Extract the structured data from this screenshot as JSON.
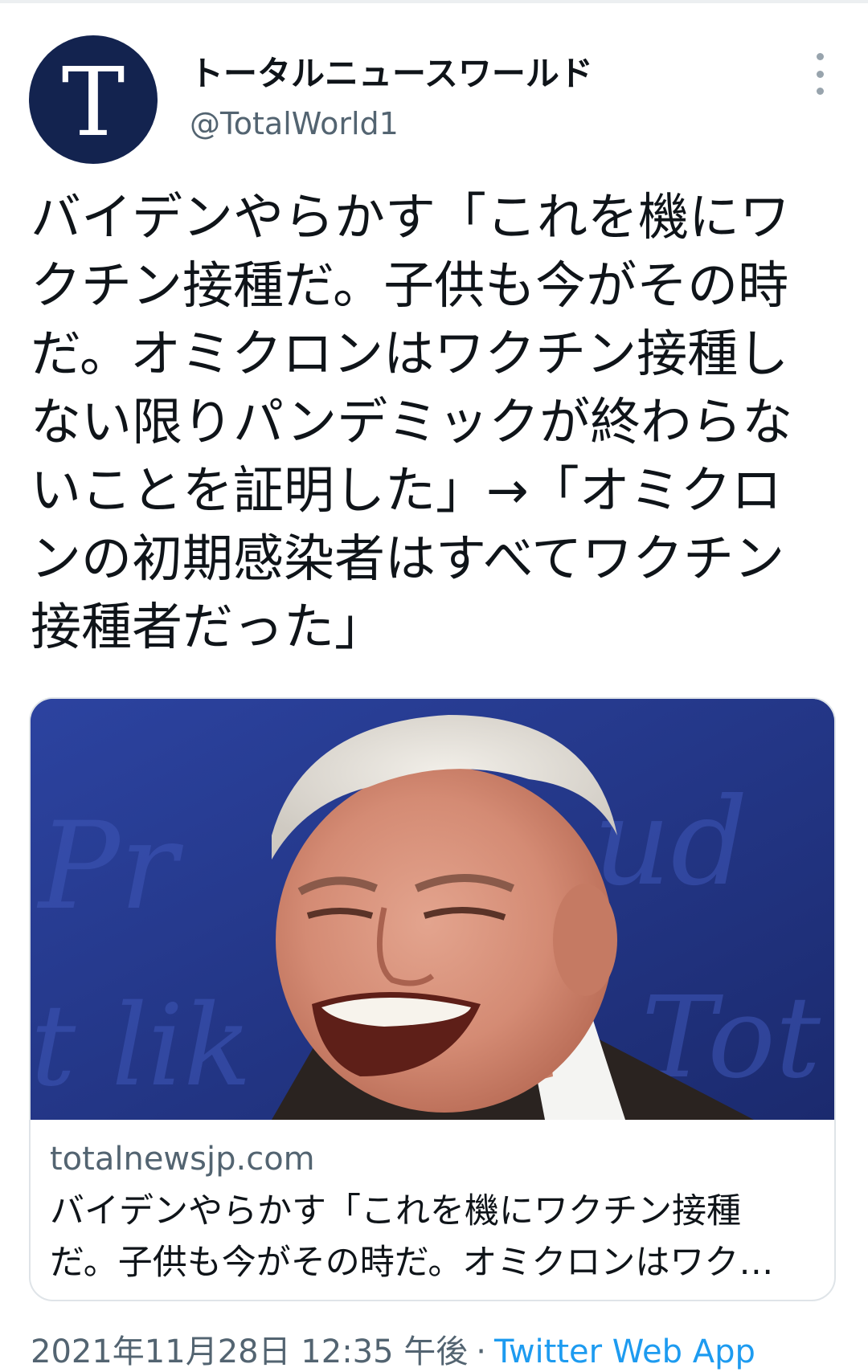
{
  "author": {
    "avatar_letter": "T",
    "display_name": "トータルニュースワールド",
    "handle": "@TotalWorld1"
  },
  "tweet": {
    "text_lines": [
      "バイデンやらかす「これを機にワ",
      "クチン接種だ。子供も今がその時",
      "だ。オミクロンはワクチン接種し",
      "ない限りパンデミックが終わらな",
      "いことを証明した」→「オミクロ",
      "ンの初期感染者はすべてワクチン",
      "接種者だった」"
    ]
  },
  "link_card": {
    "image_alt": "laughing-man-photo",
    "domain": "totalnewsjp.com",
    "title_lines": [
      "バイデンやらかす「これを機にワクチン接種",
      "だ。子供も今がその時だ。オミクロンはワク…"
    ]
  },
  "meta": {
    "timestamp": "2021年11月28日 12:35 午後",
    "separator": "·",
    "source": "Twitter Web App"
  },
  "icons": {
    "more": "more-vertical-icon"
  },
  "colors": {
    "avatar_bg": "#13234f",
    "secondary_text": "#536471",
    "link": "#1d9bf0",
    "border": "#dfe4e8"
  }
}
